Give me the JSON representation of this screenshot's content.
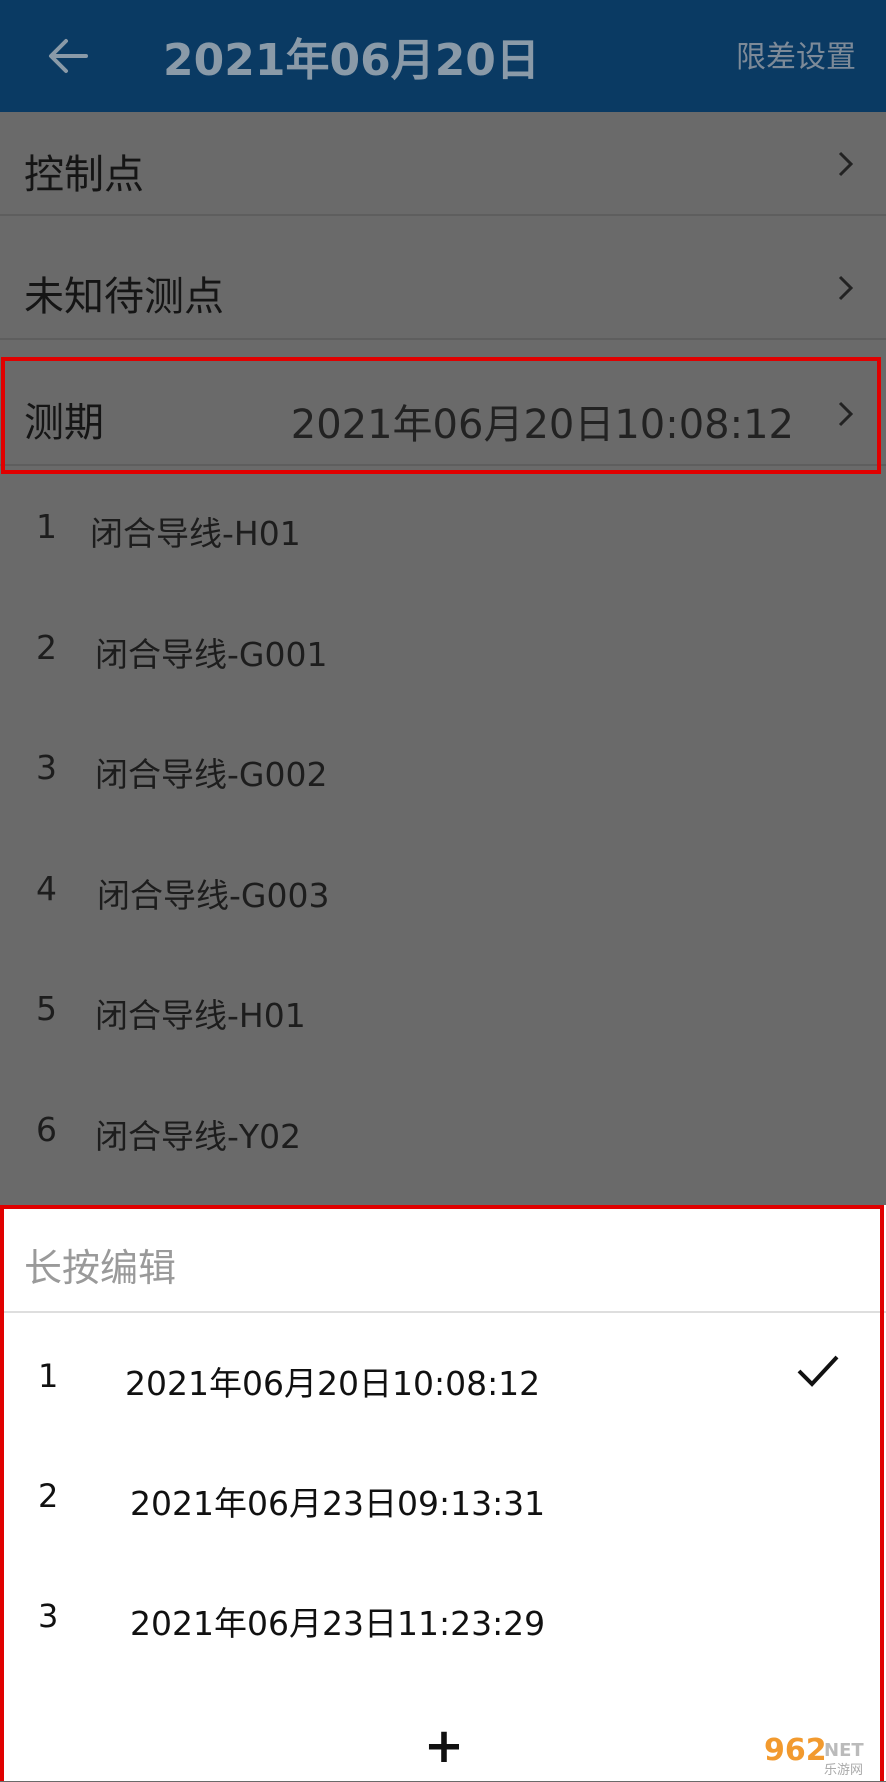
{
  "header": {
    "title": "2021年06月20日",
    "action": "限差设置"
  },
  "rows": {
    "control_points": "控制点",
    "unknown_points": "未知待测点",
    "period_label": "测期",
    "period_value": "2021年06月20日10:08:12"
  },
  "lines": [
    {
      "index": "1",
      "name": "闭合导线-H01"
    },
    {
      "index": "2",
      "name": "闭合导线-G001"
    },
    {
      "index": "3",
      "name": "闭合导线-G002"
    },
    {
      "index": "4",
      "name": "闭合导线-G003"
    },
    {
      "index": "5",
      "name": "闭合导线-H01"
    },
    {
      "index": "6",
      "name": "闭合导线-Y02"
    }
  ],
  "sheet": {
    "hint": "长按编辑",
    "periods": [
      {
        "index": "1",
        "value": "2021年06月20日10:08:12",
        "selected": true
      },
      {
        "index": "2",
        "value": "2021年06月23日09:13:31",
        "selected": false
      },
      {
        "index": "3",
        "value": "2021年06月23日11:23:29",
        "selected": false
      }
    ],
    "add_label": "+"
  },
  "watermark": {
    "brand": "962",
    "suffix": "NET",
    "sub": "乐游网"
  },
  "colors": {
    "header_bg": "#0a3a63",
    "overlay_bg": "#6a6a6a",
    "highlight": "#e00000"
  }
}
